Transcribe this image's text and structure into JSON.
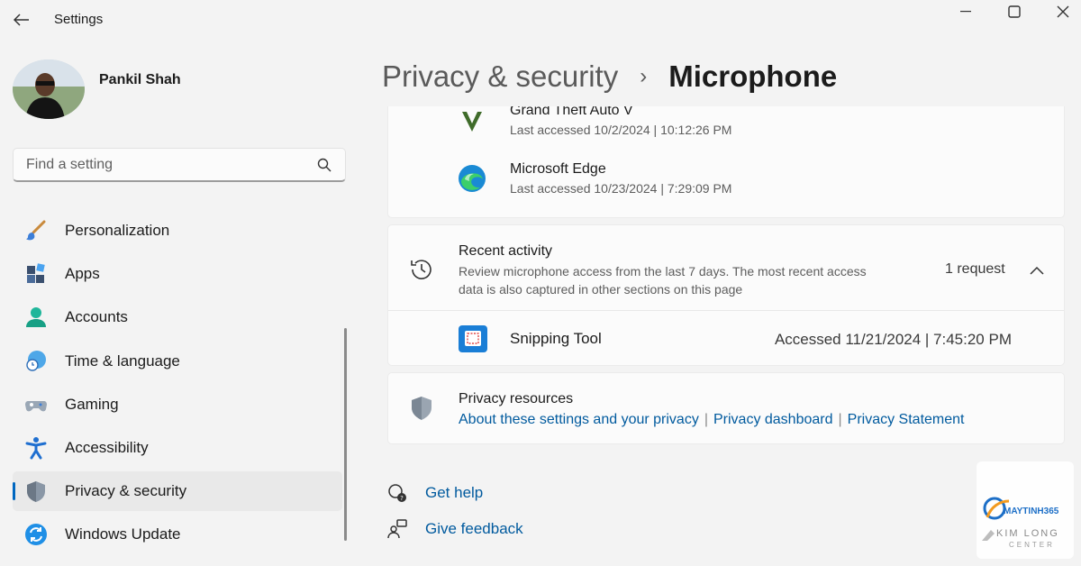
{
  "window": {
    "title": "Settings",
    "controls": [
      "minimize-icon",
      "maximize-icon",
      "close-icon"
    ]
  },
  "profile": {
    "name": "Pankil Shah"
  },
  "search": {
    "placeholder": "Find a setting"
  },
  "sidebar": {
    "items": [
      {
        "label": "Personalization",
        "icon": "brush-icon"
      },
      {
        "label": "Apps",
        "icon": "apps-icon"
      },
      {
        "label": "Accounts",
        "icon": "person-icon"
      },
      {
        "label": "Time & language",
        "icon": "globe-clock-icon"
      },
      {
        "label": "Gaming",
        "icon": "gamepad-icon"
      },
      {
        "label": "Accessibility",
        "icon": "accessibility-icon"
      },
      {
        "label": "Privacy & security",
        "icon": "shield-icon",
        "active": true
      },
      {
        "label": "Windows Update",
        "icon": "sync-icon"
      }
    ]
  },
  "breadcrumb": {
    "parent": "Privacy & security",
    "separator": "›",
    "current": "Microphone"
  },
  "apps": [
    {
      "name": "Grand Theft Auto V",
      "sub": "Last accessed 10/2/2024  |  10:12:26 PM",
      "icon": "gta-icon"
    },
    {
      "name": "Microsoft Edge",
      "sub": "Last accessed 10/23/2024  |  7:29:09 PM",
      "icon": "edge-icon"
    }
  ],
  "recent_activity": {
    "title": "Recent activity",
    "description": "Review microphone access from the last 7 days. The most recent access data is also captured in other sections on this page",
    "count": "1 request",
    "entries": [
      {
        "name": "Snipping Tool",
        "accessed": "Accessed 11/21/2024  |  7:45:20 PM",
        "icon": "snipping-tool-icon"
      }
    ]
  },
  "privacy_resources": {
    "title": "Privacy resources",
    "links": [
      "About these settings and your privacy",
      "Privacy dashboard",
      "Privacy Statement"
    ],
    "separator": "|"
  },
  "help": {
    "get_help": "Get help",
    "give_feedback": "Give feedback"
  },
  "watermark": {
    "brand": "MAYTINH365",
    "name": "KIM LONG",
    "sub": "CENTER"
  },
  "colors": {
    "accent": "#0067c0",
    "link": "#005a9e",
    "background": "#f3f3f3",
    "card": "#fbfbfb"
  }
}
